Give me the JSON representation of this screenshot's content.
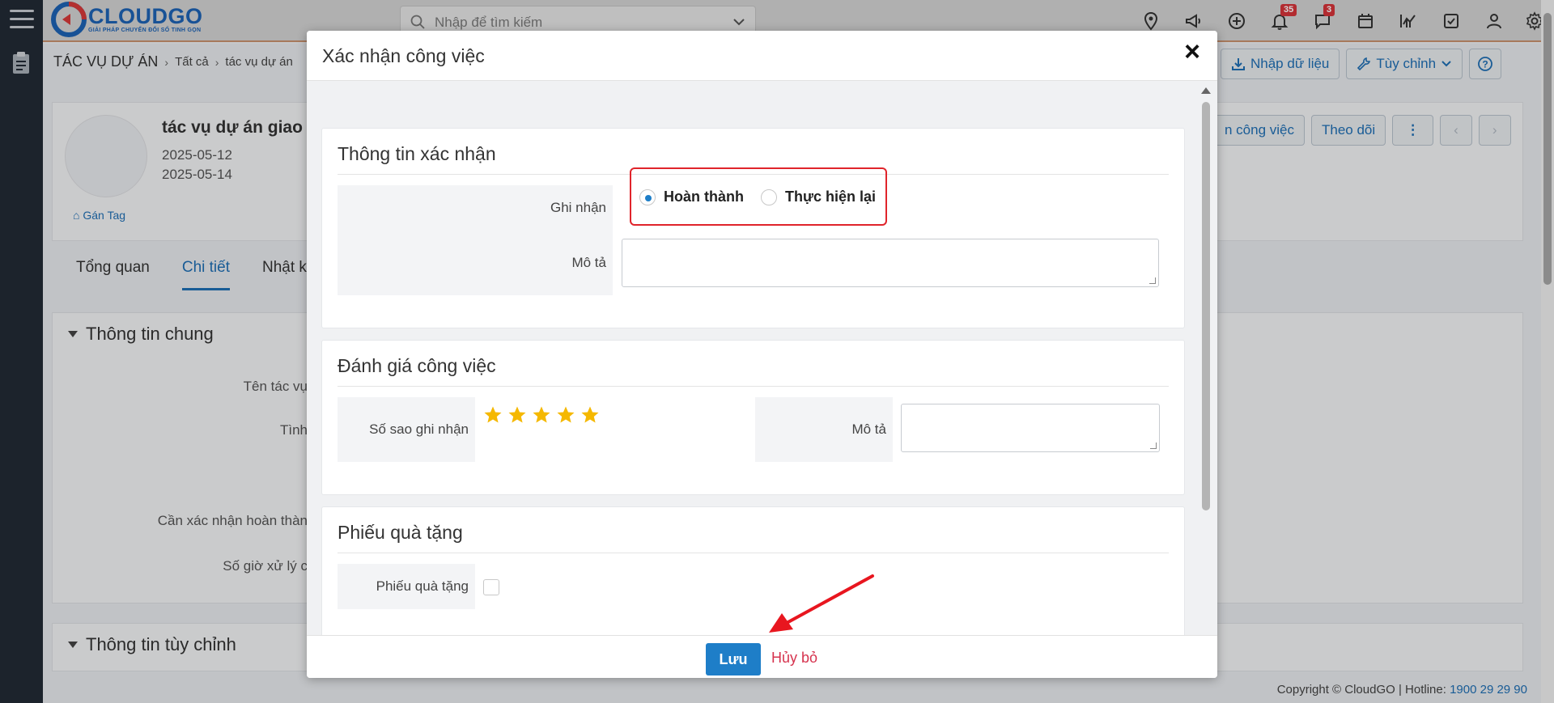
{
  "app": {
    "brand": "CLOUDGO",
    "tagline": "GIẢI PHÁP CHUYỂN ĐỔI SỐ TINH GỌN",
    "search_placeholder": "Nhập để tìm kiếm",
    "notif_count": "35",
    "chat_count": "3"
  },
  "breadcrumb": {
    "root": "TÁC VỤ DỰ ÁN",
    "level1": "Tất cả",
    "level2": "tác vụ dự án"
  },
  "toolbar": {
    "import_label": "Nhập dữ liệu",
    "customize_label": "Tùy chỉnh",
    "confirm_task_label": "n công việc",
    "follow_label": "Theo dõi"
  },
  "record": {
    "title": "tác vụ dự án giao",
    "start_date": "2025-05-12",
    "end_date": "2025-05-14",
    "tag_label": "Gán Tag"
  },
  "tabs": [
    {
      "label": "Tổng quan"
    },
    {
      "label": "Chi tiết"
    },
    {
      "label": "Nhật k"
    }
  ],
  "sections": {
    "general": "Thông tin chung",
    "custom": "Thông tin tùy chỉnh"
  },
  "fields": {
    "task_name": "Tên tác vụ",
    "status": "Tình",
    "need_confirm": "Cần xác nhận hoàn thàn",
    "hours": "Số giờ xử lý c"
  },
  "footer": {
    "copyright": "Copyright © CloudGO | Hotline:",
    "hotline": "1900 29 29 90"
  },
  "modal": {
    "title": "Xác nhận công việc",
    "close": "×",
    "confirm_info": {
      "title": "Thông tin xác nhận",
      "record_label": "Ghi nhận",
      "option_done": "Hoàn thành",
      "option_redo": "Thực hiện lại",
      "selected": "Hoàn thành",
      "desc_label": "Mô tả",
      "desc_value": ""
    },
    "evaluation": {
      "title": "Đánh giá công việc",
      "stars_label": "Số sao ghi nhận",
      "stars_value": 5,
      "stars_max": 5,
      "desc_label": "Mô tả",
      "desc_value": ""
    },
    "gift": {
      "title": "Phiếu quà tặng",
      "field_label": "Phiếu quà tặng",
      "checked": false
    },
    "save_label": "Lưu",
    "cancel_label": "Hủy bỏ"
  },
  "colors": {
    "primary": "#1e7ec8",
    "highlight_border": "#e0242b",
    "star": "#f5b800",
    "cancel": "#d6334e",
    "annotation_arrow": "#e8161f"
  }
}
